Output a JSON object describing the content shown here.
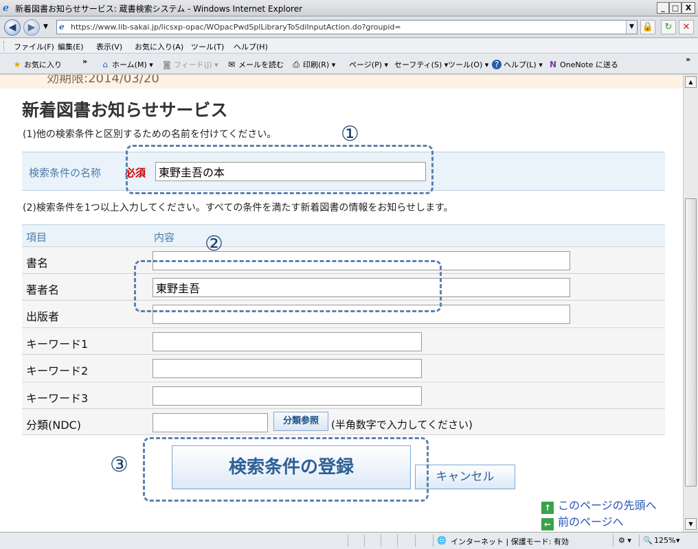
{
  "window": {
    "title": "新着図書お知らせサービス: 蔵書検索システム - Windows Internet Explorer",
    "minimize": "_",
    "maximize": "□",
    "close": "X"
  },
  "address_bar": {
    "url": "https://www.lib-sakai.jp/licsxp-opac/WOpacPwdSplLibraryToSdiInputAction.do?groupid="
  },
  "menu": [
    "ファイル(F)",
    "編集(E)",
    "表示(V)",
    "お気に入り(A)",
    "ツール(T)",
    "ヘルプ(H)"
  ],
  "command_bar": {
    "favorites": "お気に入り",
    "home": "ホーム(M)",
    "feeds": "フィード(J)",
    "mail": "メールを読む",
    "print": "印刷(R)",
    "page": "ページ(P)",
    "safety": "セーフティ(S)",
    "tools": "ツール(O)",
    "help": "ヘルプ(L)",
    "onenote": "OneNote に送る"
  },
  "page": {
    "expire_text": "効期限:2014/03/20",
    "title": "新着図書お知らせサービス",
    "step1": "(1)他の検索条件と区別するための名前を付けてください。",
    "name_label": "検索条件の名称",
    "required": "必須",
    "name_value": "東野圭吾の本",
    "step2": "(2)検索条件を1つ以上入力してください。すべての条件を満たす新着図書の情報をお知らせします。",
    "header_item": "項目",
    "header_content": "内容",
    "fields": {
      "title": {
        "label": "書名",
        "value": ""
      },
      "author": {
        "label": "著者名",
        "value": "東野圭吾"
      },
      "publisher": {
        "label": "出版者",
        "value": ""
      },
      "keyword1": {
        "label": "キーワード1",
        "value": ""
      },
      "keyword2": {
        "label": "キーワード2",
        "value": ""
      },
      "keyword3": {
        "label": "キーワード3",
        "value": ""
      },
      "ndc": {
        "label": "分類(NDC)",
        "value": ""
      }
    },
    "ndc_button": "分類参照",
    "ndc_note": "(半角数字で入力してください)",
    "submit": "検索条件の登録",
    "cancel": "キャンセル",
    "link_top": "このページの先頭へ",
    "link_prev": "前のページへ"
  },
  "markers": {
    "m1": "①",
    "m2": "②",
    "m3": "③"
  },
  "status_bar": {
    "zone": "インターネット | 保護モード: 有効",
    "zoom": "125%"
  }
}
